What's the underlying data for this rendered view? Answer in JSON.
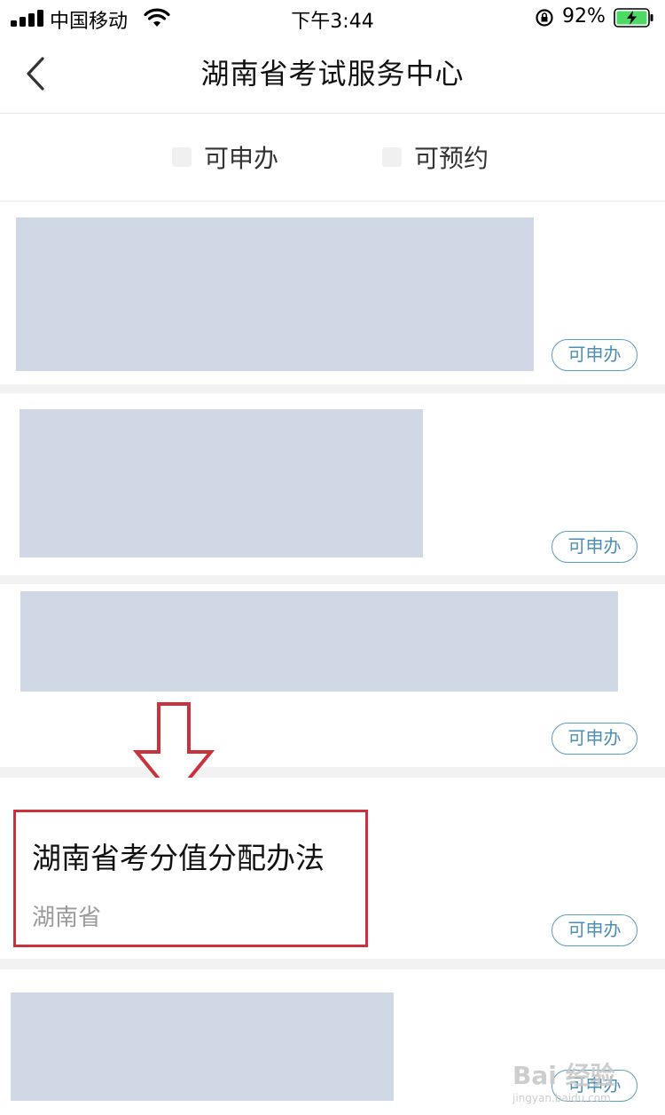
{
  "status_bar": {
    "carrier": "中国移动",
    "time": "下午3:44",
    "battery_percent": "92%"
  },
  "nav": {
    "title": "湖南省考试服务中心"
  },
  "filters": [
    {
      "label": "可申办"
    },
    {
      "label": "可预约"
    }
  ],
  "items": [
    {
      "badge": "可申办"
    },
    {
      "badge": "可申办"
    },
    {
      "badge": "可申办"
    },
    {
      "title": "湖南省考分值分配办法",
      "region": "湖南省",
      "badge": "可申办"
    },
    {
      "badge": "可申办"
    }
  ],
  "watermark": {
    "text": "Bai 经验",
    "sub": "jingyan.baidu.com"
  },
  "colors": {
    "accent": "#4b8fb5",
    "highlight_box": "#c9323c",
    "redacted": "#cfd8e4"
  }
}
